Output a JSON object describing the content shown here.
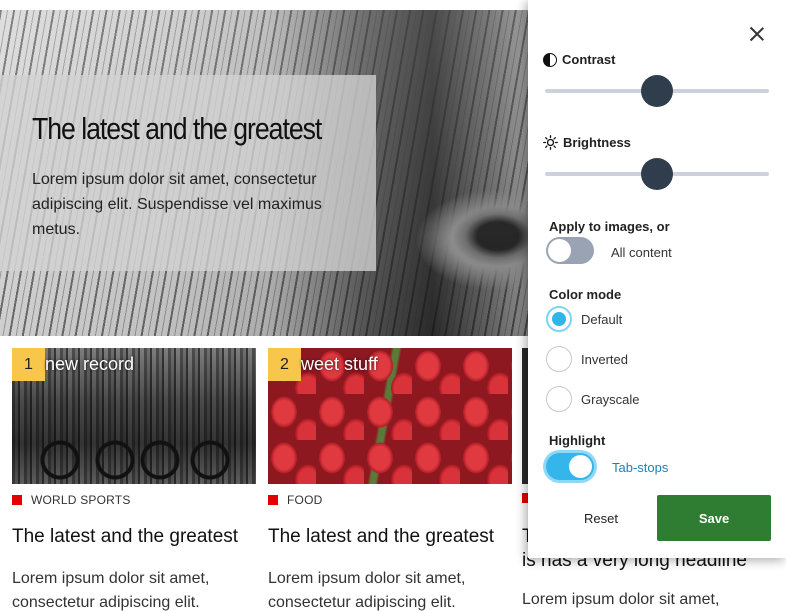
{
  "hero": {
    "title": "The latest and the greatest",
    "text": "Lorem ipsum dolor sit amet, consectetur adipiscing elit. Suspendisse vel maximus metus."
  },
  "cards": [
    {
      "number": "1",
      "image_title": "new record",
      "category": "WORLD SPORTS",
      "title": "The latest and the greatest",
      "text": "Lorem ipsum dolor sit amet, consectetur adipiscing elit."
    },
    {
      "number": "2",
      "image_title": "weet stuff",
      "category": "FOOD",
      "title": "The latest and the greatest",
      "text": "Lorem ipsum dolor sit amet, consectetur adipiscing elit."
    },
    {
      "title_line1": "T",
      "title_line2": "is has a very long headline",
      "text": "Lorem ipsum dolor sit amet,"
    }
  ],
  "panel": {
    "contrast": {
      "label": "Contrast",
      "value": 0.5
    },
    "brightness": {
      "label": "Brightness",
      "value": 0.5
    },
    "apply": {
      "label": "Apply to images, or",
      "toggle_label": "All content",
      "on": false
    },
    "color_mode": {
      "label": "Color mode",
      "options": [
        "Default",
        "Inverted",
        "Grayscale"
      ],
      "selected": "Default"
    },
    "highlight": {
      "label": "Highlight",
      "toggle_label": "Tab-stops",
      "on": true
    },
    "reset_label": "Reset",
    "save_label": "Save"
  },
  "colors": {
    "save": "#2e7d32",
    "toggle_on": "#35b6ea",
    "toggle_off": "#9aa3b3",
    "slider_thumb": "#2f3d4d",
    "badge": "#f7c64a",
    "category_marker": "#e50000",
    "link_text": "#1e7fb8"
  },
  "icons": {
    "contrast": "contrast-icon",
    "brightness": "sun-icon",
    "close": "close-icon"
  }
}
